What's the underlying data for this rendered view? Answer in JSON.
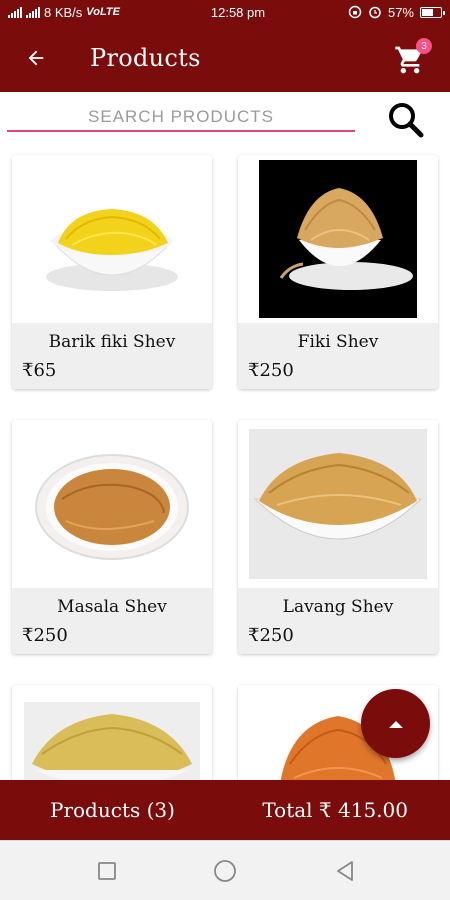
{
  "status_bar": {
    "network_speed": "8 KB/s",
    "network_type": "VoLTE",
    "time": "12:58 pm",
    "battery": "57%",
    "battery_level": 0.57
  },
  "app_bar": {
    "title": "Products",
    "cart_count": "3"
  },
  "search": {
    "placeholder": "SEARCH PRODUCTS",
    "value": ""
  },
  "products": [
    {
      "name": "Barik fiki Shev",
      "price": "₹65"
    },
    {
      "name": "Fiki Shev",
      "price": "₹250"
    },
    {
      "name": "Masala Shev",
      "price": "₹250"
    },
    {
      "name": "Lavang Shev",
      "price": "₹250"
    },
    {
      "name": "",
      "price": ""
    },
    {
      "name": "",
      "price": ""
    }
  ],
  "bottom_bar": {
    "products_label": "Products (3)",
    "total_label": "Total ₹ 415.00"
  },
  "colors": {
    "primary": "#7a0c0c",
    "accent": "#e0467c",
    "badge": "#ff4f86"
  },
  "icons": {
    "back": "arrow-left-icon",
    "cart": "shopping-cart-icon",
    "search": "magnifier-icon",
    "fab": "caret-up-icon"
  }
}
